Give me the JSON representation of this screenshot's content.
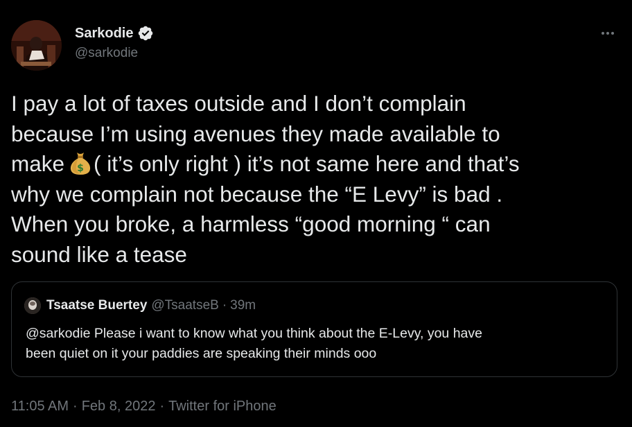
{
  "author": {
    "display_name": "Sarkodie",
    "handle": "@sarkodie",
    "verified": true
  },
  "more_icon": "more-horizontal-icon",
  "tweet": {
    "text_line1": "I pay a lot of taxes outside and I don’t complain",
    "text_line2": "because I’m using avenues they made available to",
    "text_line3_pre": "make",
    "emoji": "💰",
    "text_line3_post": "( it’s only right ) it’s not same here and that’s",
    "text_line4": "why we complain not because the “E Levy” is bad .",
    "text_line5": "When you broke, a harmless “good morning “ can",
    "text_line6": "sound like a tease"
  },
  "quote": {
    "display_name": "Tsaatse Buertey",
    "handle": "@TsaatseB",
    "separator": "·",
    "time": "39m",
    "text_line1": "@sarkodie Please i want to know what you think about the E-Levy, you have",
    "text_line2": "been quiet on it your paddies are speaking their minds ooo"
  },
  "meta": {
    "time": "11:05 AM",
    "sep1": "·",
    "date": "Feb 8, 2022",
    "sep2": "·",
    "source": "Twitter for iPhone"
  },
  "colors": {
    "background": "#000000",
    "text_primary": "#e7e9ea",
    "text_secondary": "#71767b",
    "border": "#2f3336",
    "verified_badge": "#e7e9ea"
  }
}
